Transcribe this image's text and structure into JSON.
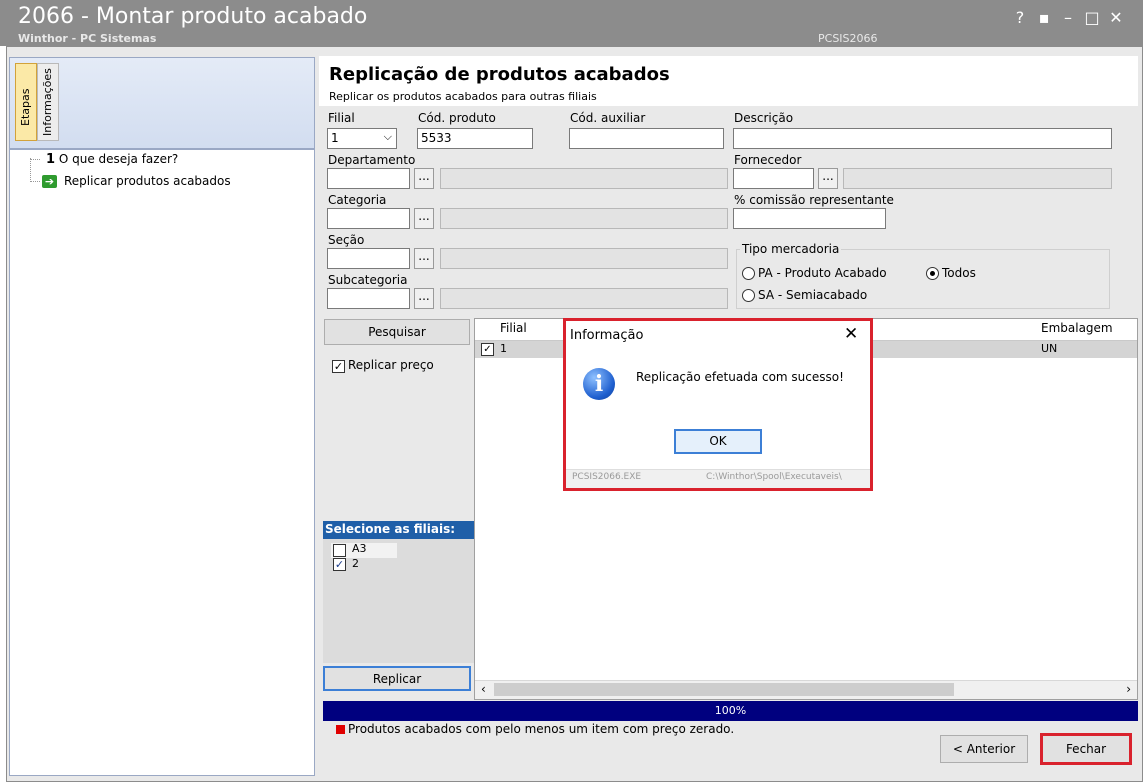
{
  "window": {
    "title": "2066 - Montar produto acabado",
    "subtitle": "Winthor - PC Sistemas",
    "code": "PCSIS2066",
    "controls": [
      "?",
      "▪",
      "–",
      "□",
      "✕"
    ]
  },
  "left_panel": {
    "tabs": [
      "Etapas",
      "Informações"
    ],
    "steps": [
      {
        "number": "1",
        "label": "O que deseja fazer?"
      },
      {
        "label": "Replicar produtos acabados"
      }
    ]
  },
  "header": {
    "title": "Replicação de produtos acabados",
    "subtitle": "Replicar os produtos acabados para outras filiais"
  },
  "form": {
    "filial_label": "Filial",
    "filial_value": "1",
    "cod_produto_label": "Cód. produto",
    "cod_produto_value": "5533",
    "cod_auxiliar_label": "Cód. auxiliar",
    "descricao_label": "Descrição",
    "departamento_label": "Departamento",
    "fornecedor_label": "Fornecedor",
    "categoria_label": "Categoria",
    "comissao_label": "% comissão representante",
    "secao_label": "Seção",
    "subcategoria_label": "Subcategoria",
    "lookup_button": "...",
    "tipo_mercadoria": {
      "legend": "Tipo mercadoria",
      "options": [
        "PA - Produto Acabado",
        "Todos",
        "SA - Semiacabado"
      ],
      "selected": "Todos"
    }
  },
  "actions": {
    "pesquisar": "Pesquisar",
    "replicar_preco": "Replicar preço",
    "replicar": "Replicar",
    "anterior": "< Anterior",
    "fechar": "Fechar"
  },
  "filiais": {
    "header": "Selecione as filiais:",
    "items": [
      {
        "label": "A3",
        "checked": false
      },
      {
        "label": "2",
        "checked": true
      }
    ]
  },
  "grid": {
    "columns": [
      "Filial",
      "Embalagem"
    ],
    "rows": [
      {
        "filial": "1",
        "embalagem": "UN",
        "checked": true
      }
    ]
  },
  "progress": {
    "label": "100%",
    "value": 1.0
  },
  "legend": {
    "text": "Produtos acabados com pelo menos um item com preço zerado.",
    "color": "#e00000"
  },
  "dialog": {
    "title": "Informação",
    "message": "Replicação efetuada com sucesso!",
    "ok": "OK",
    "footer_left": "PCSIS2066.EXE",
    "footer_right": "C:\\Winthor\\Spool\\Executaveis\\"
  }
}
